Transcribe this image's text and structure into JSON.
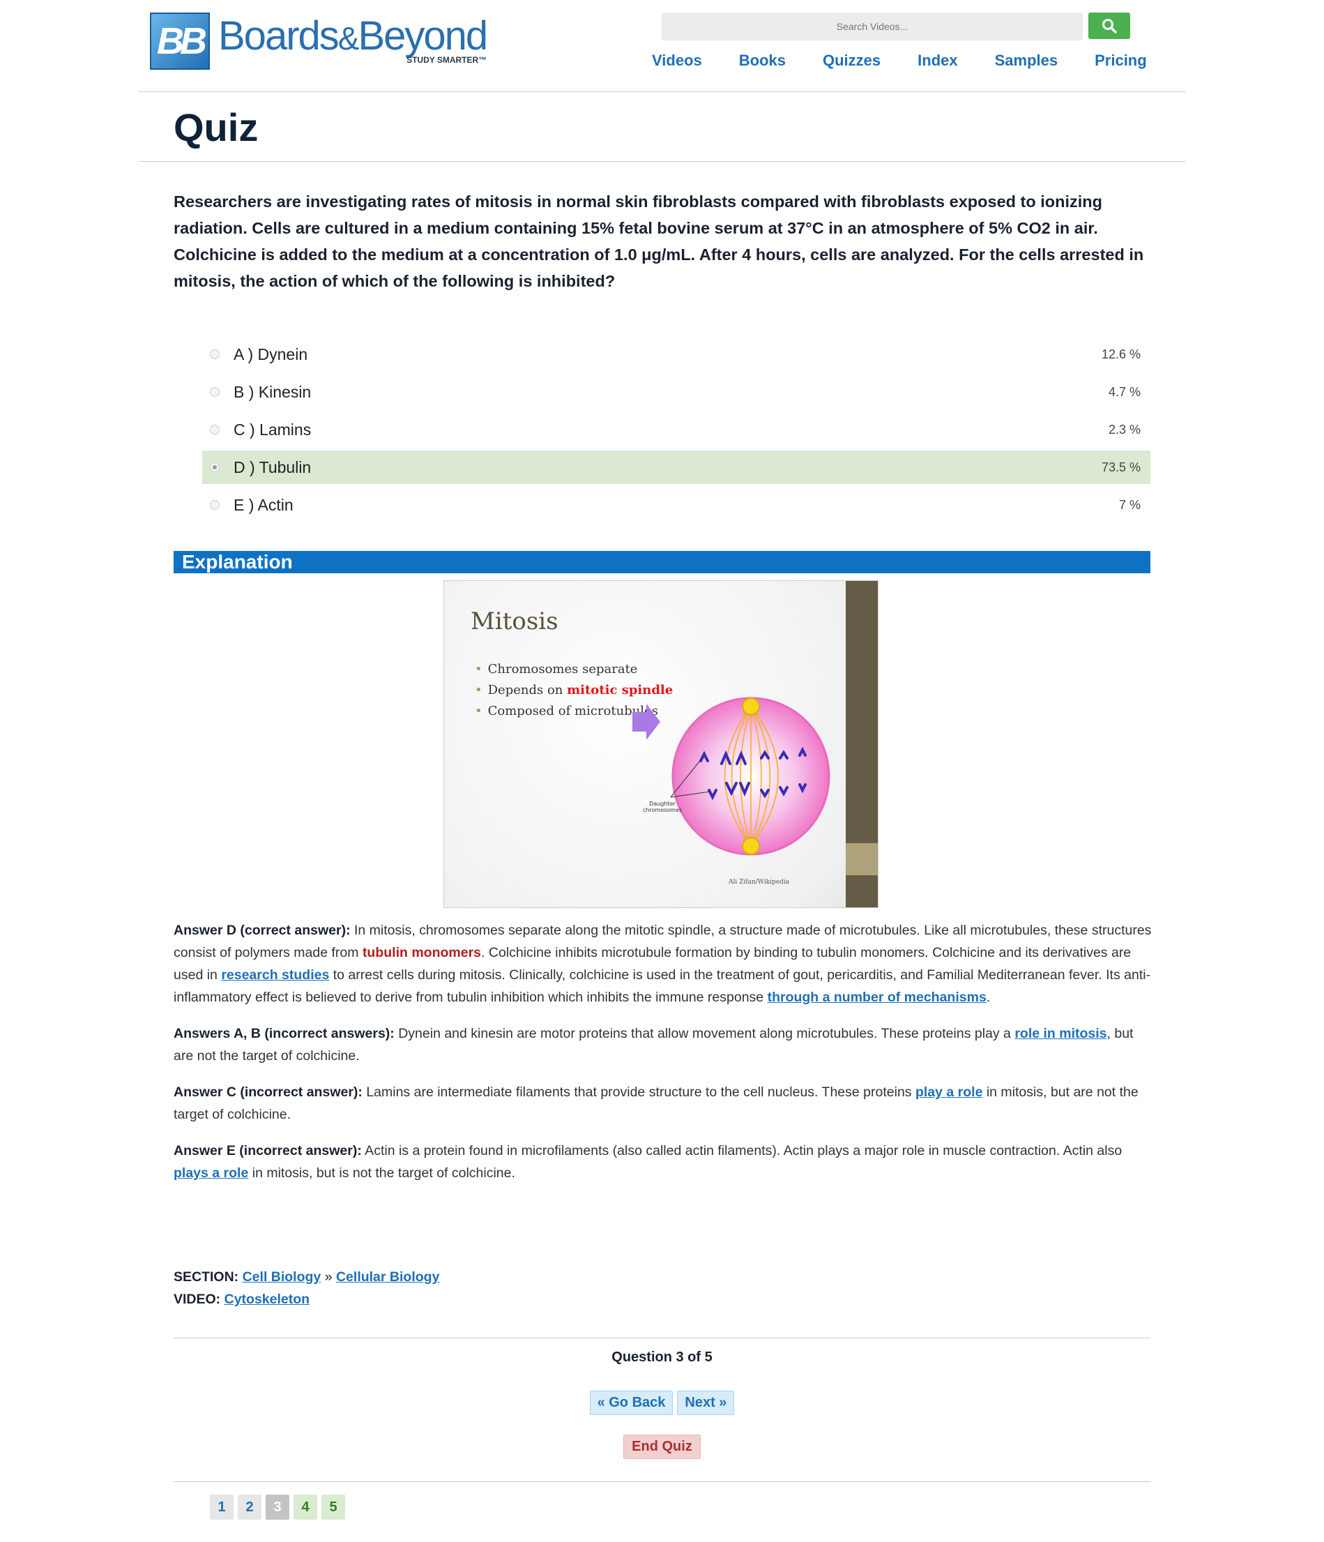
{
  "header": {
    "logo_mark": "BB",
    "logo_name_1": "Boards",
    "logo_amp": "&",
    "logo_name_2": "Beyond",
    "logo_tag": "STUDY SMARTER™",
    "search_placeholder": "Search Videos...",
    "nav": [
      "Videos",
      "Books",
      "Quizzes",
      "Index",
      "Samples",
      "Pricing"
    ]
  },
  "page_title": "Quiz",
  "question": "Researchers are investigating rates of mitosis in normal skin fibroblasts compared with fibroblasts exposed to ionizing radiation. Cells are cultured in a medium containing 15% fetal bovine serum at 37°C in an atmosphere of 5% CO2 in air. Colchicine is added to the medium at a concentration of 1.0 μg/mL. After 4 hours, cells are analyzed. For the cells arrested in mitosis, the action of which of the following is inhibited?",
  "options": [
    {
      "label": "A ) Dynein",
      "pct": "12.6 %",
      "selected": false
    },
    {
      "label": "B ) Kinesin",
      "pct": "4.7 %",
      "selected": false
    },
    {
      "label": "C ) Lamins",
      "pct": "2.3 %",
      "selected": false
    },
    {
      "label": "D ) Tubulin",
      "pct": "73.5 %",
      "selected": true
    },
    {
      "label": "E ) Actin",
      "pct": "7 %",
      "selected": false
    }
  ],
  "explanation_heading": "Explanation",
  "slide": {
    "title": "Mitosis",
    "bullet_1": "Chromosomes separate",
    "bullet_2_pre": "Depends on ",
    "bullet_2_red": "mitotic spindle",
    "bullet_3": "Composed of microtubules",
    "diagram_label_1": "Daughter",
    "diagram_label_2": "chromosomes",
    "credit": "Ali Zifan/Wikipedia"
  },
  "answers": {
    "d_head": "Answer D (correct answer):",
    "d_1": " In mitosis, chromosomes separate along the mitotic spindle, a structure made of microtubules. Like all microtubules, these structures consist of polymers made from ",
    "d_hl": "tubulin monomers",
    "d_2": ". Colchicine inhibits microtubule formation by binding to tubulin monomers. Colchicine and its derivatives are used in ",
    "d_link1": "research studies",
    "d_3": " to arrest cells during mitosis. Clinically, colchicine is used in the treatment of gout, pericarditis, and Familial Mediterranean fever. Its anti-inflammatory effect is believed to derive from tubulin inhibition which inhibits the immune response ",
    "d_link2": "through a number of mechanisms",
    "d_4": ".",
    "ab_head": "Answers A, B (incorrect answers):",
    "ab_1": " Dynein and kinesin are motor proteins that allow movement along microtubules. These proteins play a ",
    "ab_link": "role in mitosis",
    "ab_2": ", but are not the target of colchicine.",
    "c_head": "Answer C (incorrect answer):",
    "c_1": " Lamins are intermediate filaments that provide structure to the cell nucleus. These proteins ",
    "c_link": "play a role",
    "c_2": " in mitosis, but are not the target of colchicine.",
    "e_head": "Answer E (incorrect answer):",
    "e_1": " Actin is a protein found in microfilaments (also called actin filaments). Actin plays a major role in muscle contraction. Actin also ",
    "e_link": "plays a role",
    "e_2": " in mitosis, but is not the target of colchicine."
  },
  "section": {
    "section_label": "SECTION:",
    "section_link_1": "Cell Biology",
    "separator": " » ",
    "section_link_2": "Cellular Biology",
    "video_label": "VIDEO:",
    "video_link": "Cytoskeleton"
  },
  "footer": {
    "question_count": "Question 3 of 5",
    "go_back": "« Go Back",
    "next": "Next »",
    "end_quiz": "End Quiz",
    "pages": [
      "1",
      "2",
      "3",
      "4",
      "5"
    ]
  },
  "colors": {
    "brand_blue": "#1f6fb5",
    "explanation_bar": "#0e72c4",
    "correct_bg": "#dbe8d2",
    "search_btn": "#4caf50"
  }
}
